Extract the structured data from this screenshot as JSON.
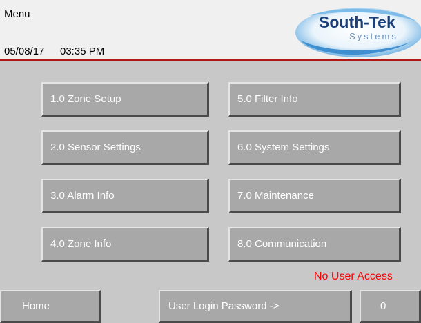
{
  "header": {
    "title": "Menu",
    "date": "05/08/17",
    "time": "03:35 PM"
  },
  "logo": {
    "line1": "South-Tek",
    "line2": "Systems",
    "colors": {
      "swoosh": "#5aa6de",
      "text": "#1a3f7a"
    }
  },
  "menu": {
    "zone_setup": "1.0 Zone Setup",
    "sensor_settings": "2.0 Sensor Settings",
    "alarm_info": "3.0 Alarm Info",
    "zone_info": "4.0 Zone Info",
    "filter_info": "5.0 Filter Info",
    "system_settings": "6.0 System Settings",
    "maintenance": "7.0 Maintenance",
    "communication": "8.0 Communication"
  },
  "status": {
    "access": "No User Access",
    "color": "#ff0000"
  },
  "footer": {
    "home": "Home",
    "login_label": "User Login Password ->",
    "password_value": "0"
  },
  "colors": {
    "panel": "#c8c8c8",
    "header_bg": "#f0f0f0",
    "header_rule": "#b01818",
    "button_face": "#a8a8a8"
  }
}
